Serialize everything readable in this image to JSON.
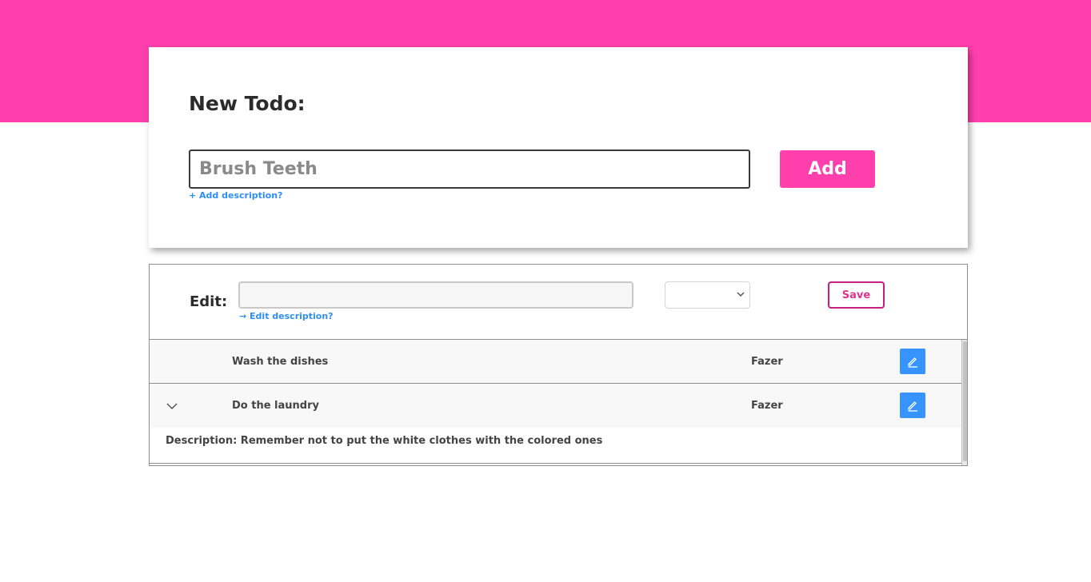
{
  "colors": {
    "brand": "#ff3fac",
    "link": "#2e8ff0",
    "edit_button": "#3794ff",
    "save_border": "#c41f7e"
  },
  "new_todo": {
    "title": "New Todo:",
    "input_placeholder": "Brush Teeth",
    "input_value": "",
    "add_description_link": "+ Add description?",
    "add_button_label": "Add"
  },
  "edit": {
    "label": "Edit:",
    "input_value": "",
    "edit_description_link": "→ Edit description?",
    "status_select_value": "",
    "save_button_label": "Save"
  },
  "todos": [
    {
      "title": "Wash the dishes",
      "status": "Fazer",
      "expanded": false,
      "icon": "pencil-icon"
    },
    {
      "title": "Do the laundry",
      "status": "Fazer",
      "expanded": true,
      "icon": "pencil-icon",
      "description": "Description: Remember not to put the white clothes with the colored ones"
    }
  ]
}
